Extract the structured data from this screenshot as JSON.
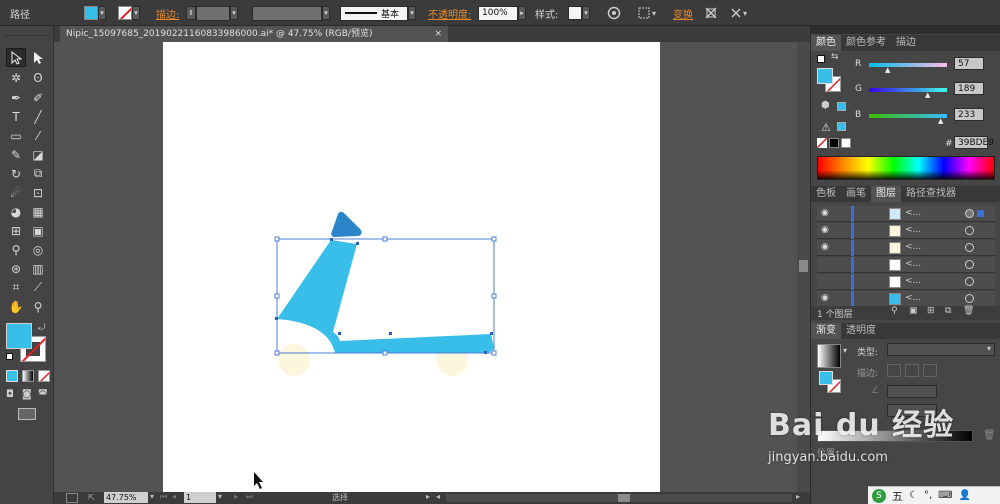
{
  "control_bar": {
    "object_type": "路径",
    "stroke_label": "描边:",
    "stroke_profile": "基本",
    "opacity_label": "不透明度:",
    "opacity_value": "100%",
    "style_label": "样式:",
    "transform_label": "变换"
  },
  "document_tab": {
    "title": "Nipic_15097685_20190221160833986000.ai* @ 47.75% (RGB/预览)",
    "close": "×"
  },
  "status_bar": {
    "zoom": "47.75%",
    "artboard": "1",
    "tool_name": "选择"
  },
  "color_panel": {
    "tabs": [
      "颜色",
      "颜色参考",
      "描边"
    ],
    "channels": [
      {
        "label": "R",
        "value": "57"
      },
      {
        "label": "G",
        "value": "189"
      },
      {
        "label": "B",
        "value": "233"
      }
    ],
    "hex_label": "#",
    "hex_value": "39BDE9"
  },
  "layers_panel": {
    "tabs": [
      "色板",
      "画笔",
      "图层",
      "路径查找器"
    ],
    "rows": [
      "<...",
      "<...",
      "<...",
      "<...",
      "<...",
      "<..."
    ],
    "footer": "1 个图层"
  },
  "gradient_panel": {
    "tabs": [
      "渐变",
      "透明度"
    ],
    "type_label": "类型:",
    "stroke_label": "描边:",
    "position_label": "位置:"
  },
  "watermark": {
    "brand": "Bai du 经验",
    "url": "jingyan.baidu.com"
  },
  "taskbar": {
    "label": "五"
  },
  "colors": {
    "fill": "#39BDE9",
    "accent_link": "#e98b2a"
  }
}
